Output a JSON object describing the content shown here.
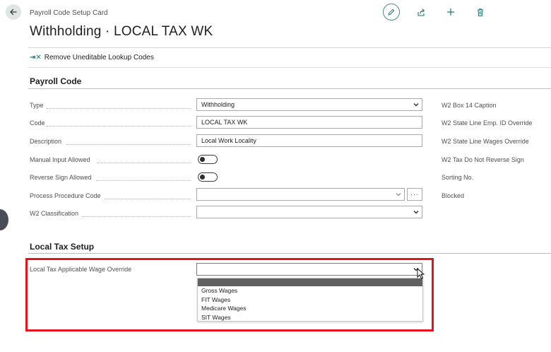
{
  "header": {
    "breadcrumb": "Payroll Code Setup Card",
    "title": "Withholding · LOCAL TAX WK"
  },
  "action_bar": {
    "remove_label": "Remove Uneditable Lookup Codes"
  },
  "payroll_code": {
    "section_title": "Payroll Code",
    "type_label": "Type",
    "type_value": "Withholding",
    "code_label": "Code",
    "code_value": "LOCAL TAX WK",
    "description_label": "Description",
    "description_value": "Local Work Locality",
    "manual_input_label": "Manual Input Allowed",
    "manual_input_on": false,
    "reverse_sign_label": "Reverse Sign Allowed",
    "reverse_sign_on": false,
    "process_procedure_label": "Process Procedure Code",
    "process_procedure_value": "",
    "w2_class_label": "W2 Classification",
    "w2_class_value": "",
    "more_label": "···"
  },
  "right_fields": {
    "w2_box14": "W2 Box 14 Caption",
    "w2_state_emp": "W2 State Line Emp. ID Override",
    "w2_state_wages": "W2 State Line Wages Override",
    "w2_tax_reverse": "W2 Tax Do Not Reverse Sign",
    "sorting_no": "Sorting No.",
    "blocked": "Blocked"
  },
  "local_tax": {
    "section_title": "Local Tax Setup",
    "wage_override_label": "Local Tax Applicable Wage Override",
    "wage_override_value": "",
    "options": [
      "",
      "Gross Wages",
      "FIT Wages",
      "Medicare Wages",
      "SIT Wages"
    ]
  },
  "colors": {
    "accent": "#1a7a73",
    "highlight": "#e0161f",
    "selected_option": "#616161"
  }
}
